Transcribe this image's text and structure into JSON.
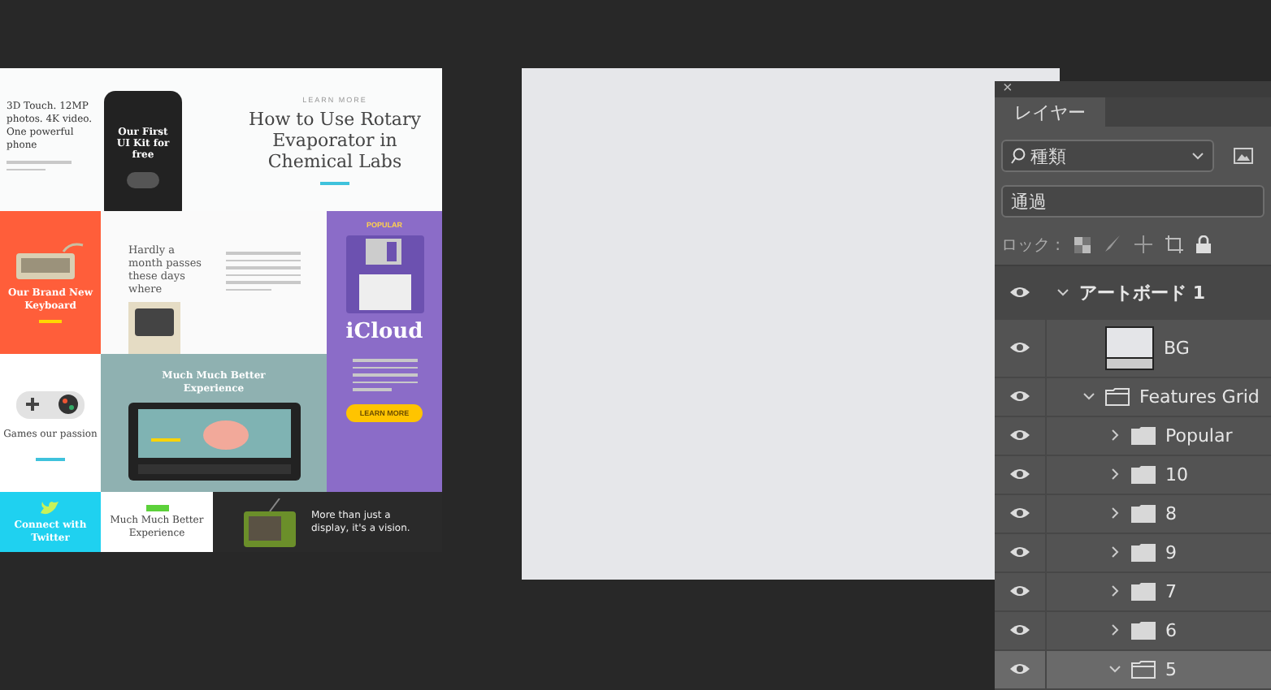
{
  "artboard": {
    "phone_tile": {
      "caption": "3D Touch. 12MP photos. 4K video. One powerful phone",
      "screen_title": "Our First UI Kit for free"
    },
    "article_tile": {
      "eyebrow": "LEARN MORE",
      "heading": "How to Use Rotary Evaporator in Chemical Labs"
    },
    "keyboard_tile": {
      "title": "Our Brand New Keyboard"
    },
    "news_tile": {
      "heading": "Hardly a month passes these days where"
    },
    "icloud_tile": {
      "badge": "POPULAR",
      "title": "iCloud",
      "button": "LEARN MORE"
    },
    "games_tile": {
      "title": "Games our passion"
    },
    "tablet_tile": {
      "title": "Much Much Better Experience"
    },
    "twitter_tile": {
      "title": "Connect with Twitter"
    },
    "experience_tile": {
      "title": "Much Much Better Experience"
    },
    "tv_tile": {
      "title": "More than just a display, it's a vision."
    }
  },
  "layers_panel": {
    "close": "×",
    "tab": "レイヤー",
    "filter": {
      "value": "種類"
    },
    "blend_mode": "通過",
    "lock_label": "ロック :",
    "layers": [
      {
        "name": "アートボード 1",
        "kind": "artboard",
        "visible": true,
        "expanded": true,
        "selected": false,
        "children": [
          {
            "name": "BG",
            "kind": "layer",
            "visible": true,
            "selected": false
          },
          {
            "name": "Features Grid",
            "kind": "group",
            "visible": true,
            "expanded": true,
            "selected": false,
            "children": [
              {
                "name": "Popular",
                "kind": "group",
                "visible": true,
                "expanded": false,
                "selected": false
              },
              {
                "name": "10",
                "kind": "group",
                "visible": true,
                "expanded": false,
                "selected": false
              },
              {
                "name": "8",
                "kind": "group",
                "visible": true,
                "expanded": false,
                "selected": false
              },
              {
                "name": "9",
                "kind": "group",
                "visible": true,
                "expanded": false,
                "selected": false
              },
              {
                "name": "7",
                "kind": "group",
                "visible": true,
                "expanded": false,
                "selected": false
              },
              {
                "name": "6",
                "kind": "group",
                "visible": true,
                "expanded": false,
                "selected": false
              },
              {
                "name": "5",
                "kind": "group",
                "visible": true,
                "expanded": true,
                "selected": true
              }
            ]
          }
        ]
      }
    ]
  }
}
